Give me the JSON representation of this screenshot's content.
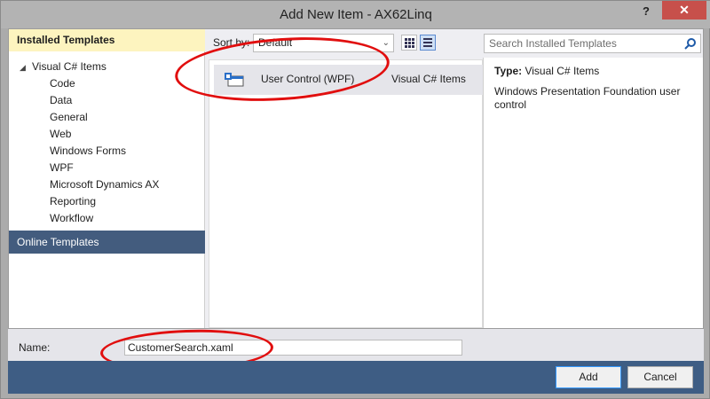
{
  "window": {
    "title": "Add New Item - AX62Linq",
    "help_label": "?",
    "close_label": "✕"
  },
  "sidebar": {
    "installed_header": "Installed Templates",
    "root_label": "Visual C# Items",
    "root_arrow": "◢",
    "items": [
      {
        "label": "Code"
      },
      {
        "label": "Data"
      },
      {
        "label": "General"
      },
      {
        "label": "Web"
      },
      {
        "label": "Windows Forms"
      },
      {
        "label": "WPF"
      },
      {
        "label": "Microsoft Dynamics AX"
      },
      {
        "label": "Reporting"
      },
      {
        "label": "Workflow"
      }
    ],
    "online_templates": "Online Templates"
  },
  "toolbar": {
    "sort_label": "Sort by:",
    "sort_value": "Default",
    "sort_chevron": "⌄",
    "search_placeholder": "Search Installed Templates"
  },
  "templates": [
    {
      "name": "User Control (WPF)",
      "category": "Visual C# Items",
      "icon": "user-control-icon"
    }
  ],
  "details": {
    "type_label": "Type:",
    "type_value": "Visual C# Items",
    "description": "Windows Presentation Foundation user control"
  },
  "name_field": {
    "label": "Name:",
    "value": "CustomerSearch.xaml"
  },
  "buttons": {
    "add": "Add",
    "cancel": "Cancel"
  },
  "colors": {
    "accent": "#3e5d84",
    "selection": "#435c7e",
    "header_highlight": "#fdf4bf",
    "annotation": "#e10e0e",
    "close": "#c7504b"
  }
}
